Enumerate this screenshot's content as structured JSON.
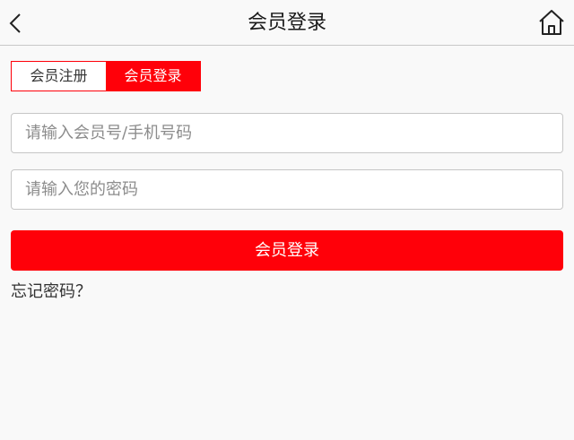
{
  "header": {
    "title": "会员登录",
    "back_icon": "chevron-left-icon",
    "home_icon": "home-icon"
  },
  "tabs": [
    {
      "label": "会员注册",
      "active": false
    },
    {
      "label": "会员登录",
      "active": true
    }
  ],
  "form": {
    "account_placeholder": "请输入会员号/手机号码",
    "account_value": "",
    "password_placeholder": "请输入您的密码",
    "password_value": "",
    "submit_label": "会员登录",
    "forgot_label": "忘记密码？"
  },
  "colors": {
    "accent": "#ff0009",
    "background": "#f9f9f9",
    "border": "#c6c6c6"
  }
}
